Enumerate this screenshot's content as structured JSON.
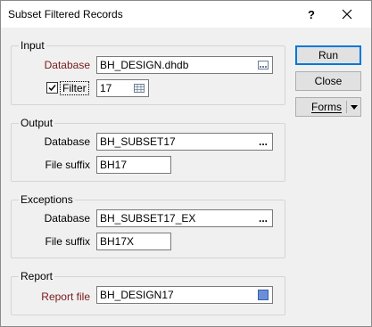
{
  "window": {
    "title": "Subset Filtered Records",
    "help_glyph": "?"
  },
  "input": {
    "title": "Input",
    "database_label": "Database",
    "database_value": "BH_DESIGN.dhdb",
    "filter_label": "Filter",
    "filter_checked": true,
    "filter_value": "17"
  },
  "output": {
    "title": "Output",
    "database_label": "Database",
    "database_value": "BH_SUBSET17",
    "browse_glyph": "...",
    "suffix_label": "File suffix",
    "suffix_value": "BH17"
  },
  "exceptions": {
    "title": "Exceptions",
    "database_label": "Database",
    "database_value": "BH_SUBSET17_EX",
    "browse_glyph": "...",
    "suffix_label": "File suffix",
    "suffix_value": "BH17X"
  },
  "report": {
    "title": "Report",
    "file_label": "Report file",
    "file_value": "BH_DESIGN17"
  },
  "buttons": {
    "run": "Run",
    "close": "Close",
    "forms": "Forms"
  },
  "colors": {
    "required_label": "#7a1a1a",
    "default_border": "#0078d7"
  }
}
